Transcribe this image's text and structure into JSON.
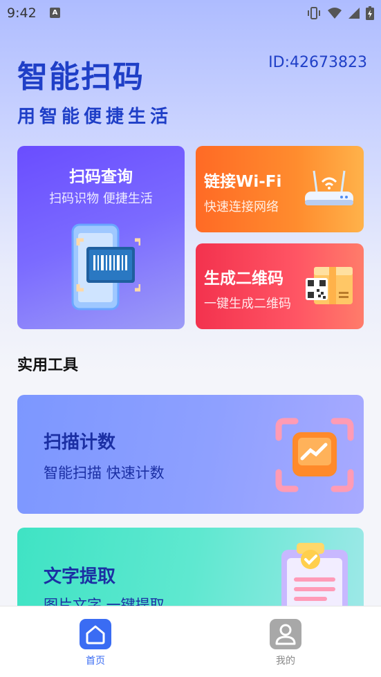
{
  "status_bar": {
    "time": "9:42",
    "notif_letter": "A"
  },
  "header": {
    "title": "智能扫码",
    "user_id": "ID:42673823",
    "subtitle": "用智能便捷生活"
  },
  "cards": {
    "scan": {
      "title": "扫码查询",
      "subtitle": "扫码识物 便捷生活",
      "icon": "barcode-phone-icon"
    },
    "wifi": {
      "title": "链接Wi-Fi",
      "subtitle": "快速连接网络",
      "icon": "router-icon"
    },
    "qr": {
      "title": "生成二维码",
      "subtitle": "一键生成二维码",
      "icon": "qr-box-icon"
    }
  },
  "tools": {
    "section_title": "实用工具",
    "items": [
      {
        "title": "扫描计数",
        "subtitle": "智能扫描 快速计数",
        "icon": "scan-count-icon"
      },
      {
        "title": "文字提取",
        "subtitle": "图片文字 一键提取",
        "icon": "clipboard-icon"
      }
    ]
  },
  "tab_bar": {
    "tabs": [
      {
        "label": "首页",
        "icon": "home-icon",
        "active": true
      },
      {
        "label": "我的",
        "icon": "profile-icon",
        "active": false
      }
    ]
  },
  "colors": {
    "primary": "#1f3fc7",
    "tab_active": "#3a6cf3",
    "tab_inactive": "#888888"
  }
}
